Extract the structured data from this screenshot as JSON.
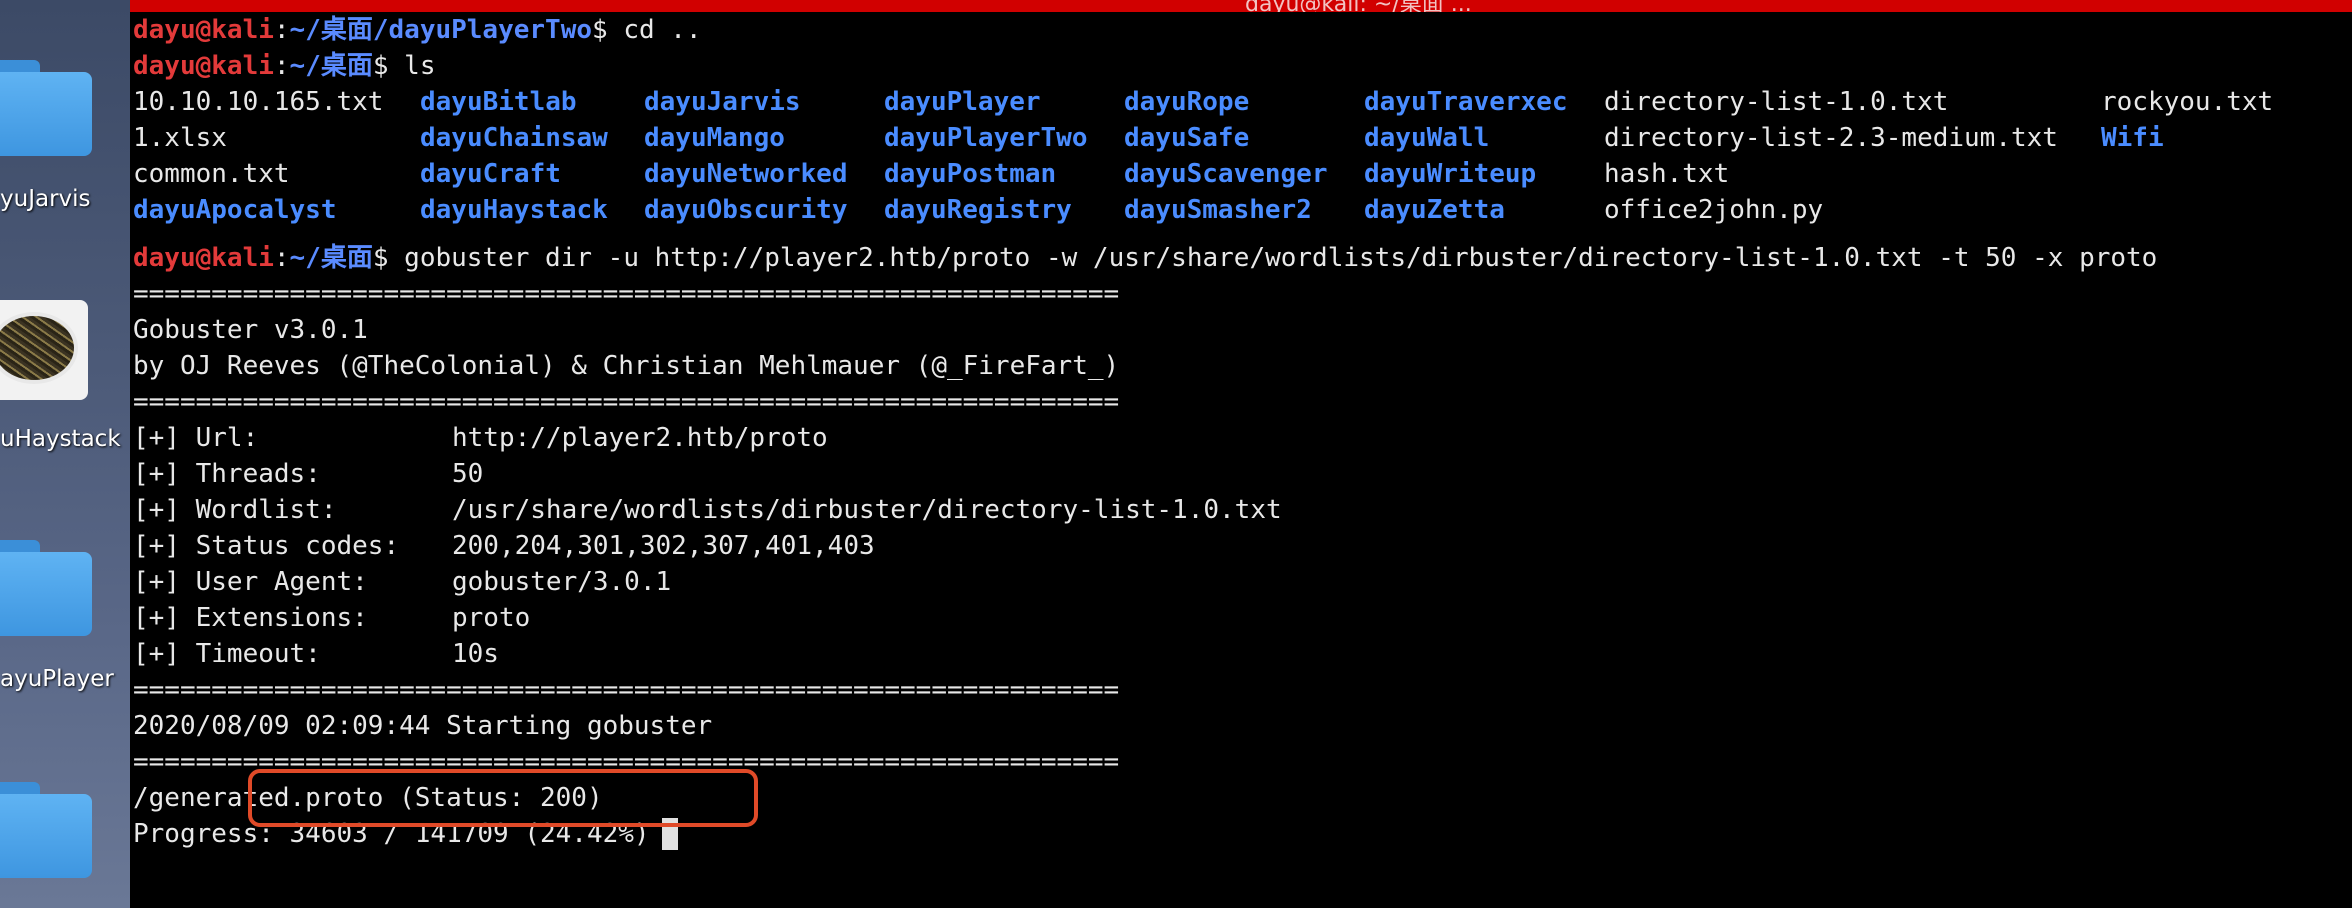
{
  "titlebar": {
    "title": "dayu@kali: ~/桌面 ..."
  },
  "desktop": {
    "icons": [
      {
        "label": "yuJarvis",
        "icon": "folder-icon"
      },
      {
        "label": "uHaystack",
        "icon": "image-thumbnail"
      },
      {
        "label": "ayuPlayer",
        "icon": "folder-icon"
      },
      {
        "label": "",
        "icon": "folder-icon"
      }
    ]
  },
  "prompt": {
    "user": "dayu@kali",
    "sep": ":"
  },
  "lines": {
    "l1": {
      "path": "~/桌面/dayuPlayerTwo",
      "cmd": "$ cd .."
    },
    "l2": {
      "path": "~/桌面",
      "cmd": "$ ls"
    },
    "l7": {
      "path": "~/桌面",
      "cmd": "$ gobuster dir -u http://player2.htb/proto -w /usr/share/wordlists/dirbuster/directory-list-1.0.txt -t 50 -x proto"
    }
  },
  "ls": {
    "rows": [
      [
        "10.10.10.165.txt",
        "dayuBitlab",
        "dayuJarvis",
        "dayuPlayer",
        "dayuRope",
        "dayuTraverxec",
        "directory-list-1.0.txt",
        "rockyou.txt"
      ],
      [
        "1.xlsx",
        "dayuChainsaw",
        "dayuMango",
        "dayuPlayerTwo",
        "dayuSafe",
        "dayuWall",
        "directory-list-2.3-medium.txt",
        "Wifi"
      ],
      [
        "common.txt",
        "dayuCraft",
        "dayuNetworked",
        "dayuPostman",
        "dayuScavenger",
        "dayuWriteup",
        "hash.txt",
        ""
      ],
      [
        "dayuApocalyst",
        "dayuHaystack",
        "dayuObscurity",
        "dayuRegistry",
        "dayuSmasher2",
        "dayuZetta",
        "office2john.py",
        ""
      ]
    ],
    "dir_flags": [
      [
        false,
        true,
        true,
        true,
        true,
        true,
        false,
        false
      ],
      [
        false,
        true,
        true,
        true,
        true,
        true,
        false,
        true
      ],
      [
        false,
        true,
        true,
        true,
        true,
        true,
        false,
        false
      ],
      [
        true,
        true,
        true,
        true,
        true,
        true,
        false,
        false
      ]
    ]
  },
  "gobuster": {
    "separator": "===============================================================",
    "banner": "Gobuster v3.0.1",
    "authors": "by OJ Reeves (@TheColonial) & Christian Mehlmauer (@_FireFart_)",
    "config": [
      {
        "key": "[+] Url:",
        "value": "http://player2.htb/proto"
      },
      {
        "key": "[+] Threads:",
        "value": "50"
      },
      {
        "key": "[+] Wordlist:",
        "value": "/usr/share/wordlists/dirbuster/directory-list-1.0.txt"
      },
      {
        "key": "[+] Status codes:",
        "value": "200,204,301,302,307,401,403"
      },
      {
        "key": "[+] User Agent:",
        "value": "gobuster/3.0.1"
      },
      {
        "key": "[+] Extensions:",
        "value": "proto"
      },
      {
        "key": "[+] Timeout:",
        "value": "10s"
      }
    ],
    "start": "2020/08/09 02:09:44 Starting gobuster",
    "result": "/generated.proto (Status: 200)",
    "progress": "Progress: 34603 / 141709 (24.42%)"
  },
  "colors": {
    "user": "#e33a3a",
    "path": "#5a8bff",
    "dir": "#4a8cff",
    "text": "#e8e8e8",
    "highlight": "#e04a28",
    "titlebar": "#d10000"
  }
}
